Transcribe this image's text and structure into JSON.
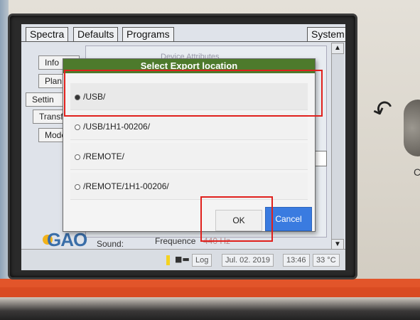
{
  "tabs": [
    "Spectra",
    "Defaults",
    "Programs",
    "System"
  ],
  "side_buttons": [
    "Info",
    "Plan",
    "Settin",
    "Transf",
    "Mode"
  ],
  "background": {
    "panel_title": "Device Attributes",
    "sound_label": "Sound:",
    "frequence_label": "Frequence",
    "frequence_value": "440 Hz",
    "logo": "GAO"
  },
  "dialog": {
    "title": "Select Export location",
    "options": [
      {
        "label": "/USB/",
        "selected": true
      },
      {
        "label": "/USB/1H1-00206/",
        "selected": false
      },
      {
        "label": "/REMOTE/",
        "selected": false
      },
      {
        "label": "/REMOTE/1H1-00206/",
        "selected": false
      }
    ],
    "ok_label": "OK",
    "cancel_label": "Cancel"
  },
  "status_bar": {
    "log_label": "Log",
    "date": "Jul. 02. 2019",
    "time": "13:46",
    "temperature": "33 °C"
  },
  "device_side_letter": "C",
  "colors": {
    "dialog_header": "#4d7a2c",
    "cancel_button": "#3a7be0",
    "annotation_red": "#e0201c"
  }
}
